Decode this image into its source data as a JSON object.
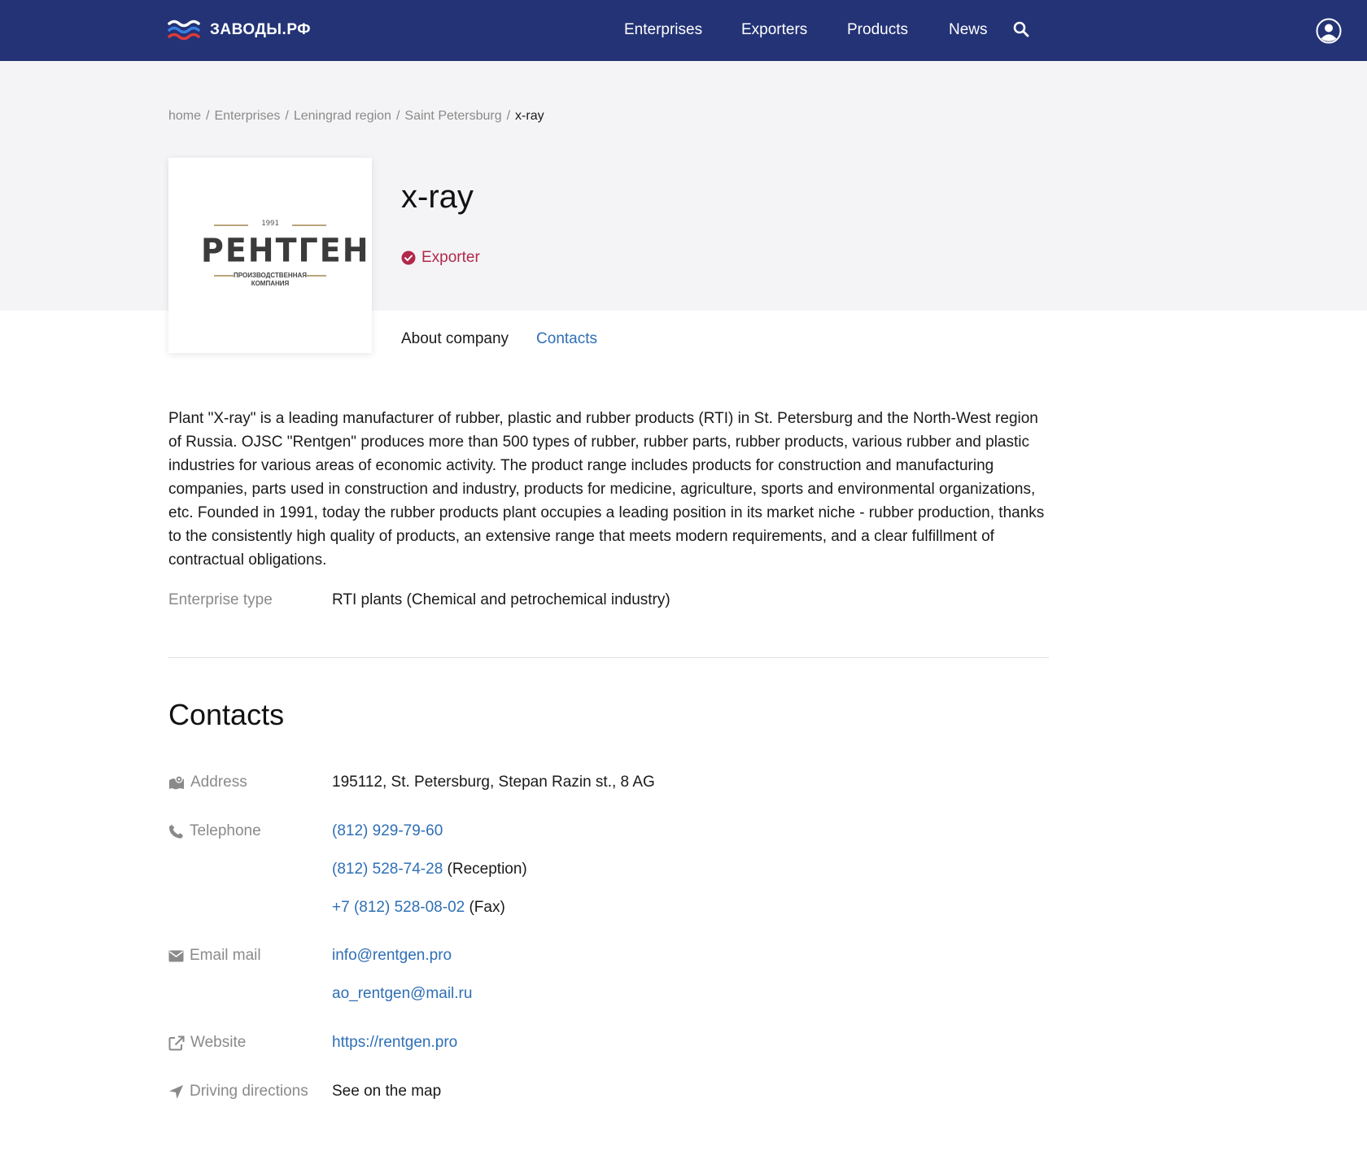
{
  "header": {
    "logo_text": "ЗАВОДЫ.РФ",
    "nav": [
      "Enterprises",
      "Exporters",
      "Products",
      "News"
    ]
  },
  "breadcrumb": {
    "items": [
      "home",
      "Enterprises",
      "Leningrad region",
      "Saint Petersburg"
    ],
    "current": "x-ray",
    "separator": "/"
  },
  "company": {
    "name": "x-ray",
    "badge": "Exporter",
    "logo": {
      "year": "1991",
      "name": "РЕНТГЕН",
      "subtitle_line1": "ПРОИЗВОДСТВЕННАЯ",
      "subtitle_line2": "КОМПАНИЯ"
    }
  },
  "tabs": [
    "About company",
    "Contacts"
  ],
  "description": "Plant \"X-ray\" is a leading manufacturer of rubber, plastic and rubber products (RTI) in St. Petersburg and the North-West region of Russia. OJSC \"Rentgen\" produces more than 500 types of rubber, rubber parts, rubber products, various rubber and plastic industries for various areas of economic activity. The product range includes products for construction and manufacturing companies, parts used in construction and industry, products for medicine, agriculture, sports and environmental organizations, etc. Founded in 1991, today the rubber products plant occupies a leading position in its market niche - rubber production, thanks to the consistently high quality of products, an extensive range that meets modern requirements, and a clear fulfillment of contractual obligations.",
  "properties": {
    "enterprise_type_label": "Enterprise type",
    "enterprise_type_value": "RTI plants (Chemical and petrochemical industry)"
  },
  "contacts": {
    "heading": "Contacts",
    "address_label": "Address",
    "address": "195112, St. Petersburg, Stepan Razin st., 8 AG",
    "telephone_label": "Telephone",
    "phones": [
      {
        "number": "(812) 929-79-60",
        "note": ""
      },
      {
        "number": "(812) 528-74-28",
        "note": "(Reception)"
      },
      {
        "number": "+7 (812) 528-08-02",
        "note": "(Fax)"
      }
    ],
    "email_label": "Email mail",
    "emails": [
      "info@rentgen.pro",
      "ao_rentgen@mail.ru"
    ],
    "website_label": "Website",
    "website": "https://rentgen.pro",
    "directions_label": "Driving directions",
    "directions_link": "See on the map"
  },
  "colors": {
    "header_bg": "#233375",
    "link": "#2f6fb5",
    "exporter": "#b2284a",
    "hero_bg": "#f4f4f6"
  },
  "icons": [
    "wave-logo-icon",
    "search-icon",
    "user-account-icon",
    "check-circle-icon",
    "map-icon",
    "phone-icon",
    "envelope-icon",
    "external-link-icon",
    "navigation-arrow-icon"
  ]
}
